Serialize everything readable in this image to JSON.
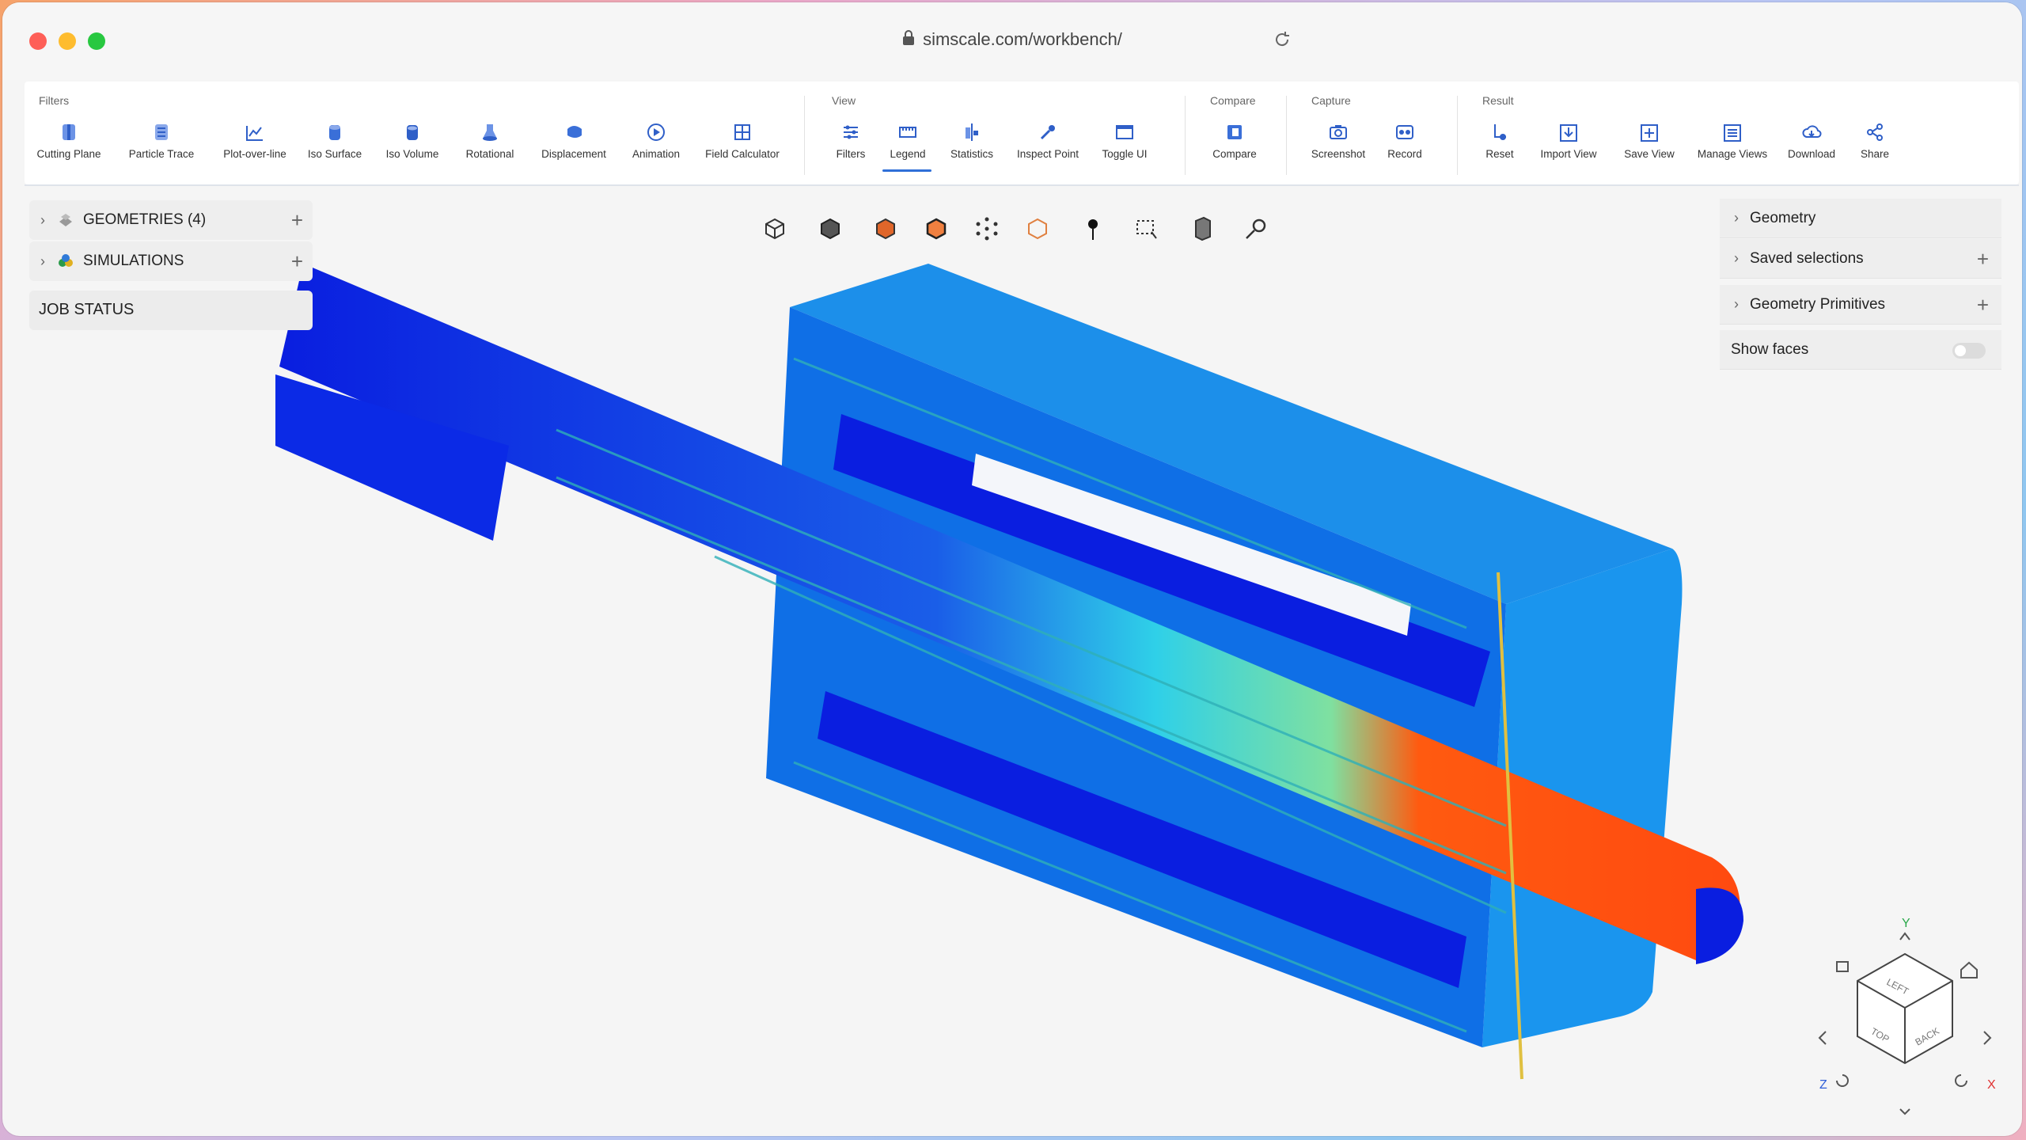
{
  "browser": {
    "url": "simscale.com/workbench/"
  },
  "ribbon": {
    "groups": {
      "filters": "Filters",
      "view": "View",
      "compare": "Compare",
      "capture": "Capture",
      "result": "Result"
    },
    "buttons": {
      "cutting_plane": "Cutting Plane",
      "particle_trace": "Particle Trace",
      "plot_over_line": "Plot-over-line",
      "iso_surface": "Iso Surface",
      "iso_volume": "Iso Volume",
      "rotational": "Rotational",
      "displacement": "Displacement",
      "animation": "Animation",
      "field_calculator": "Field Calculator",
      "filters": "Filters",
      "legend": "Legend",
      "statistics": "Statistics",
      "inspect_point": "Inspect Point",
      "toggle_ui": "Toggle UI",
      "compare": "Compare",
      "screenshot": "Screenshot",
      "record": "Record",
      "reset": "Reset",
      "import_view": "Import View",
      "save_view": "Save View",
      "manage_views": "Manage Views",
      "download": "Download",
      "share": "Share"
    },
    "active_tab": "Legend"
  },
  "left_panel": {
    "geometries": "GEOMETRIES (4)",
    "simulations": "SIMULATIONS",
    "job_status": "JOB STATUS"
  },
  "right_panel": {
    "geometry": "Geometry",
    "saved_selections": "Saved selections",
    "geometry_primitives": "Geometry Primitives",
    "show_faces": "Show faces",
    "show_faces_on": false
  },
  "nav_cube": {
    "y": "Y",
    "z": "Z",
    "x": "X",
    "left": "LEFT",
    "top": "TOP",
    "back": "BACK"
  },
  "colors": {
    "accent": "#2f6fd8",
    "icon_blue": "#3a6fd8",
    "field_low": "#0a1ee0",
    "field_mid": "#1a9be8",
    "field_high": "#ff4a10"
  }
}
